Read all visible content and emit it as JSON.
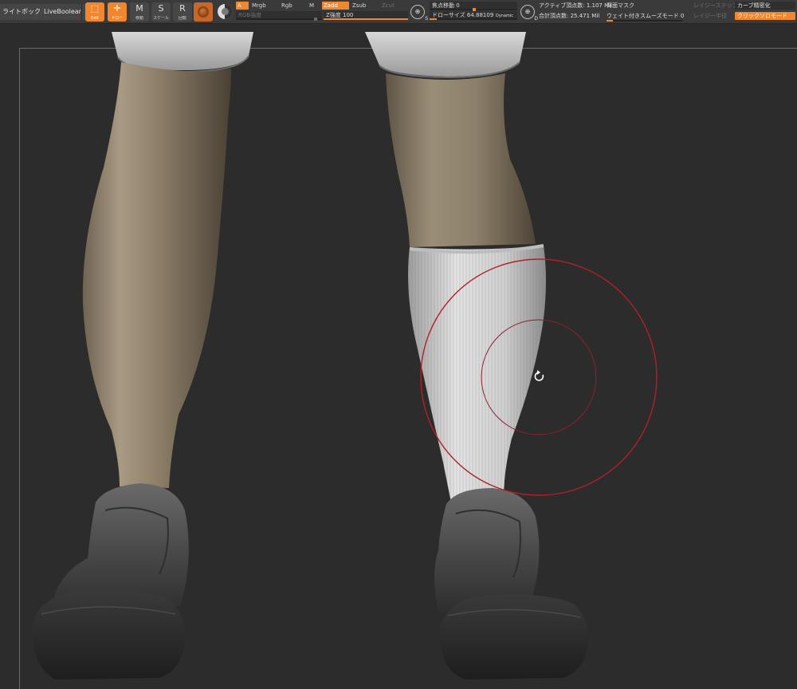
{
  "toolbar": {
    "lightbox_label": "ライトボックス",
    "liveboolean_label": "LiveBoolean",
    "tools": [
      {
        "glyph": "⬚",
        "caption": "Edit"
      },
      {
        "glyph": "✛",
        "caption": "ドロー"
      },
      {
        "glyph": "M",
        "caption": "移動"
      },
      {
        "glyph": "S",
        "caption": "スケール"
      },
      {
        "glyph": "R",
        "caption": "回転"
      }
    ],
    "modes": {
      "a": "A",
      "mrgb": "Mrgb",
      "rgb": "Rgb",
      "m": "M",
      "zadd": "Zadd",
      "zsub": "Zsub",
      "zcut": "Zcut"
    },
    "rgb_intensity_label": "RGB強度",
    "z_intensity_label": "Z強度 100",
    "z_intensity_value": 100,
    "focal_shift_label": "焦点移動 0",
    "draw_size_label": "ドローサイズ 64.88109",
    "dynamic_label": "Dynamic",
    "s_icon_letter": "S",
    "d_icon_letter": "D",
    "active_points_label": "アクティブ頂点数: 1.107 Mil",
    "backface_mask_label": "背面マスク",
    "total_points_label": "合計頂点数: 25.471 Mil",
    "weighted_smooth_label": "ウェイト付きスムーズモード 0",
    "lazy_step_label": "レイジーステップ",
    "lazy_radius_label": "レイジー半径",
    "curve_precision_label": "カーブ精密化",
    "click_solo_label": "クリックソロモード"
  }
}
